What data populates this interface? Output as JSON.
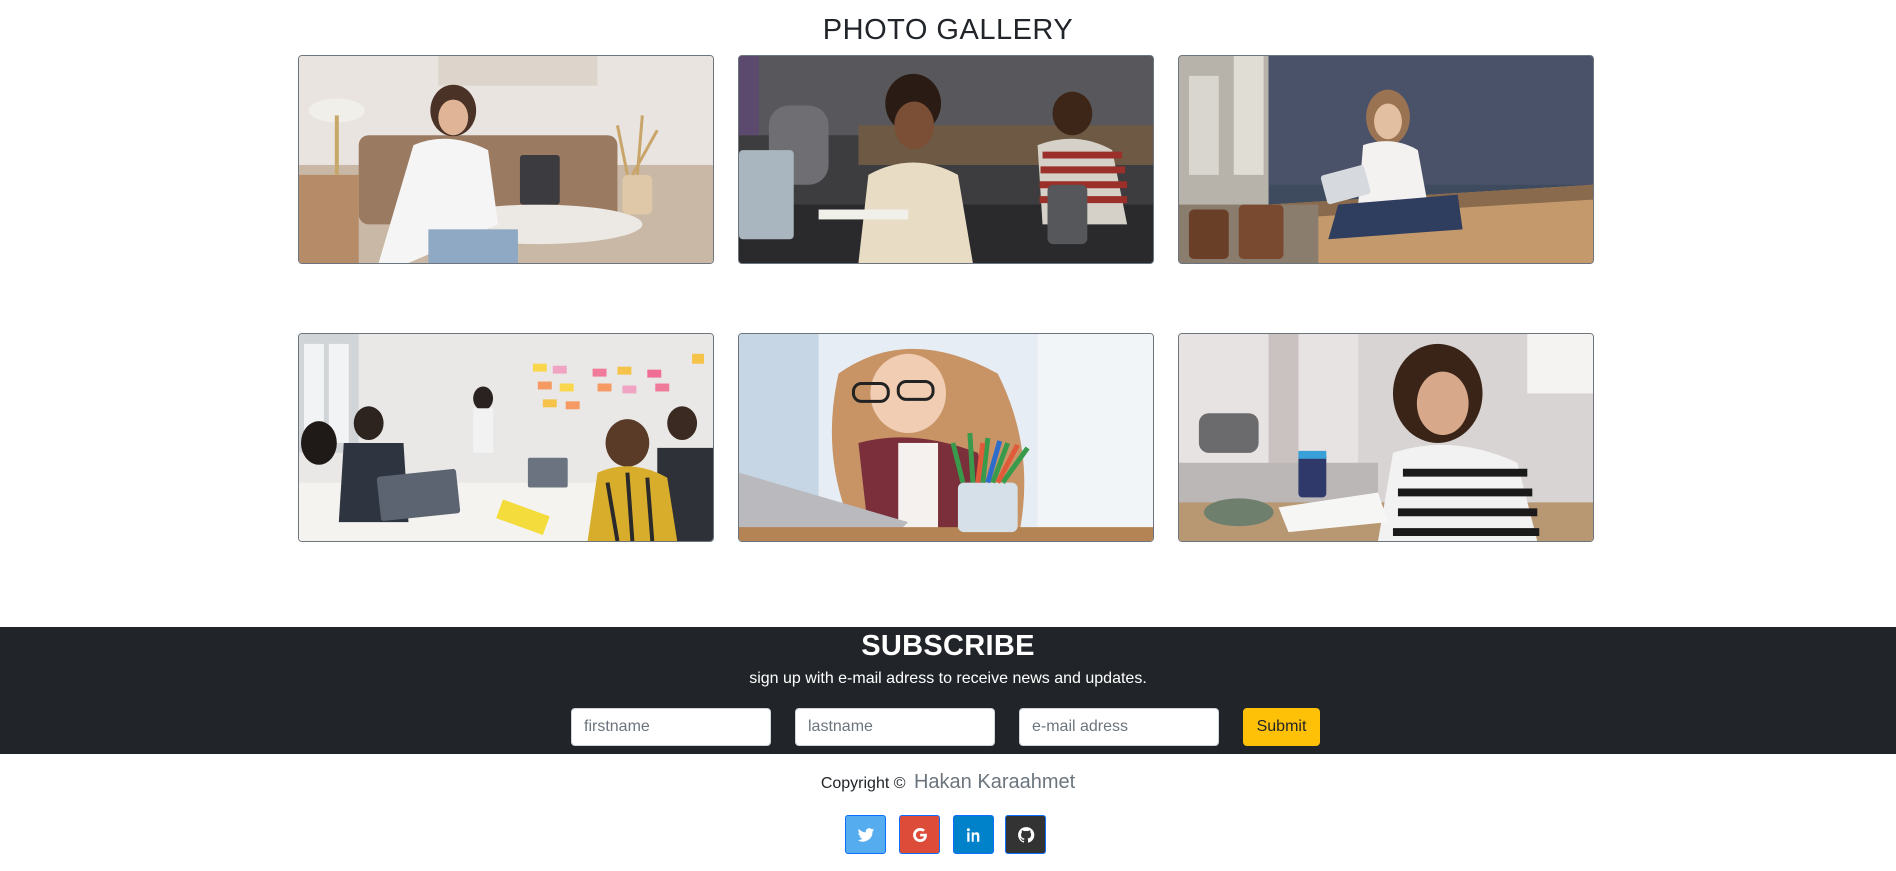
{
  "gallery": {
    "title": "PHOTO GALLERY",
    "photos": [
      {
        "name": "woman-writing-at-laptop-living-room"
      },
      {
        "name": "call-center-workers-with-headsets"
      },
      {
        "name": "woman-with-laptop-sitting-on-bench"
      },
      {
        "name": "team-meeting-sticky-notes"
      },
      {
        "name": "student-biting-pencil-at-laptop"
      },
      {
        "name": "smiling-student-at-desk"
      }
    ]
  },
  "subscribe": {
    "title": "SUBSCRIBE",
    "subtitle": "sign up with e-mail adress to receive news and updates.",
    "firstname_placeholder": "firstname",
    "lastname_placeholder": "lastname",
    "email_placeholder": "e-mail adress",
    "submit_label": "Submit"
  },
  "footer": {
    "copyright_prefix": "Copyright ©",
    "author": "Hakan Karaahmet",
    "social": [
      {
        "icon": "twitter-icon",
        "color": "#55acee"
      },
      {
        "icon": "google-icon",
        "color": "#dd4b39"
      },
      {
        "icon": "linkedin-icon",
        "color": "#0082ca"
      },
      {
        "icon": "github-icon",
        "color": "#333333"
      }
    ]
  }
}
